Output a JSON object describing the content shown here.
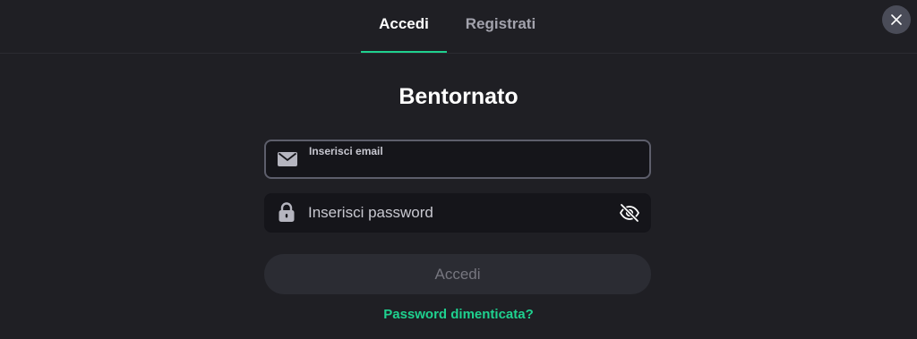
{
  "tabs": [
    {
      "label": "Accedi",
      "active": true
    },
    {
      "label": "Registrati",
      "active": false
    }
  ],
  "title": "Bentornato",
  "email": {
    "label": "Inserisci email",
    "value": "",
    "icon": "envelope-icon"
  },
  "password": {
    "placeholder": "Inserisci password",
    "value": "",
    "icon": "lock-icon",
    "toggle_icon": "eye-off-icon"
  },
  "submit_label": "Accedi",
  "forgot_label": "Password dimenticata?",
  "close_icon": "close-icon",
  "colors": {
    "background": "#1f1f24",
    "accent": "#1fd18f",
    "field_background": "#15151a",
    "button_disabled": "#2b2c33"
  }
}
